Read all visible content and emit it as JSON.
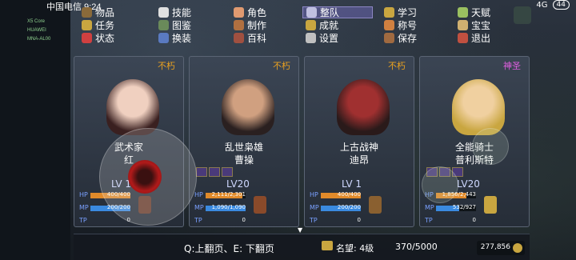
{
  "status_bar": {
    "carrier_time": "中国电信 9:24",
    "battery": "44",
    "network": "4G"
  },
  "device_info": [
    "X5 Core",
    "HUAWEI",
    "MNA-AL00"
  ],
  "menu": {
    "items": [
      {
        "label": "物品",
        "icon": "bag-icon"
      },
      {
        "label": "任务",
        "icon": "quest-icon"
      },
      {
        "label": "状态",
        "icon": "status-icon"
      },
      {
        "label": "技能",
        "icon": "skill-icon"
      },
      {
        "label": "图鉴",
        "icon": "codex-icon"
      },
      {
        "label": "换装",
        "icon": "outfit-icon"
      },
      {
        "label": "角色",
        "icon": "character-icon"
      },
      {
        "label": "制作",
        "icon": "craft-icon"
      },
      {
        "label": "百科",
        "icon": "encyclopedia-icon"
      },
      {
        "label": "整队",
        "icon": "formation-icon",
        "selected": true
      },
      {
        "label": "成就",
        "icon": "achievement-icon"
      },
      {
        "label": "设置",
        "icon": "gear-icon"
      },
      {
        "label": "学习",
        "icon": "study-icon"
      },
      {
        "label": "称号",
        "icon": "title-icon"
      },
      {
        "label": "保存",
        "icon": "save-icon"
      },
      {
        "label": "天赋",
        "icon": "talent-icon"
      },
      {
        "label": "宝宝",
        "icon": "pet-icon"
      },
      {
        "label": "退出",
        "icon": "exit-icon"
      }
    ]
  },
  "characters": [
    {
      "rank": "不朽",
      "class": "武术家",
      "name": "红",
      "level": "LV 1",
      "hp": "400/400",
      "hp_frac": 1.0,
      "mp": "200/200",
      "mp_frac": 1.0,
      "tp": "0",
      "show_equip": false
    },
    {
      "rank": "不朽",
      "class": "乱世枭雄",
      "name": "曹操",
      "level": "LV20",
      "hp": "2,111/2,301",
      "hp_frac": 0.92,
      "mp": "1,090/1,090",
      "mp_frac": 1.0,
      "tp": "0",
      "show_equip": true
    },
    {
      "rank": "不朽",
      "class": "上古战神",
      "name": "迪昂",
      "level": "LV 1",
      "hp": "400/400",
      "hp_frac": 1.0,
      "mp": "200/200",
      "mp_frac": 1.0,
      "tp": "0",
      "show_equip": false
    },
    {
      "rank": "神圣",
      "class": "全能骑士",
      "name": "普利斯特",
      "level": "LV20",
      "hp": "1,856/2,443",
      "hp_frac": 0.76,
      "mp": "532/927",
      "mp_frac": 0.57,
      "tp": "0",
      "show_equip": true
    }
  ],
  "stat_labels": {
    "hp": "HP",
    "mp": "MP",
    "tp": "TP"
  },
  "colors": {
    "rank_immortal": "#e8a020",
    "rank_holy": "#e060e0",
    "hp_bar": "#e08a2a",
    "mp_bar": "#3a8ae0"
  },
  "bottom": {
    "page_hint": "Q:上翻页、E: 下翻页",
    "fame_label": "名望: 4级",
    "fame_progress": "370/5000",
    "gold": "277,856"
  }
}
